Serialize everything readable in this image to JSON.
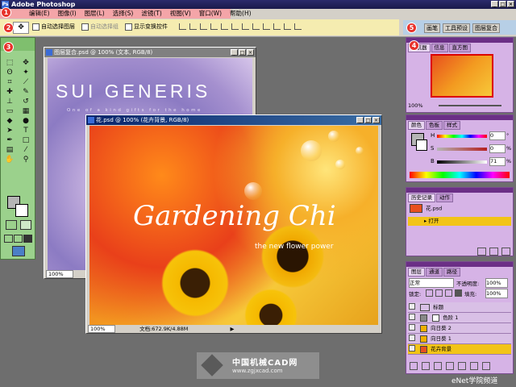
{
  "titlebar": {
    "title": "Adobe Photoshop"
  },
  "menu": [
    "编辑(E)",
    "图像(I)",
    "图层(L)",
    "选择(S)",
    "滤镜(T)",
    "视图(V)",
    "窗口(W)",
    "帮助(H)"
  ],
  "badges": [
    "1",
    "2",
    "3",
    "4",
    "5"
  ],
  "options": {
    "auto_select_layer": "自动选择图层",
    "auto_select_group": "自动选择组",
    "show_transform": "显示变换控件"
  },
  "well_tabs": [
    "画笔",
    "工具预设",
    "图层复合"
  ],
  "doc1": {
    "title": "图层复合.psd @ 100% (文本, RGB/8)",
    "headline": "SUI GENERIS",
    "tagline": "One of a kind gifts for the home",
    "zoom": "100%"
  },
  "doc2": {
    "title": "花.psd @ 100% (花卉背景, RGB/8)",
    "headline": "Gardening Chi",
    "subline": "the new flower power",
    "zoom": "100%",
    "status": "文档:672.9K/4.88M"
  },
  "navigator": {
    "tabs": [
      "导航器",
      "信息",
      "直方图"
    ],
    "zoom": "100%"
  },
  "color": {
    "tabs": [
      "颜色",
      "色板",
      "样式"
    ],
    "h_label": "H",
    "h_value": "0",
    "h_unit": "°",
    "s_label": "S",
    "s_value": "0",
    "s_unit": "%",
    "b_label": "B",
    "b_value": "71",
    "b_unit": "%"
  },
  "history": {
    "tabs": [
      "历史记录",
      "动作"
    ],
    "snapshot": "花.psd",
    "step": "打开"
  },
  "layers": {
    "tabs": [
      "图层",
      "通道",
      "路径"
    ],
    "blend_mode": "正常",
    "opacity_label": "不透明度:",
    "opacity": "100%",
    "lock_label": "锁定:",
    "fill_label": "填充:",
    "fill": "100%",
    "rows": [
      "标题",
      "色阶 1",
      "向日葵 2",
      "向日葵 1",
      "花卉背景"
    ]
  },
  "watermark": {
    "name": "中国机械CAD网",
    "url": "www.zgjxcad.com"
  },
  "credit": "eNet学院频道",
  "colors": {
    "accent_red": "#e8322b",
    "menu_highlight": "#f4a5a8",
    "options_highlight": "#f5ecb0",
    "toolbox_green": "#9bd18c",
    "panel_purple": "#d6b3e6",
    "selected_layer": "#f2c418"
  }
}
